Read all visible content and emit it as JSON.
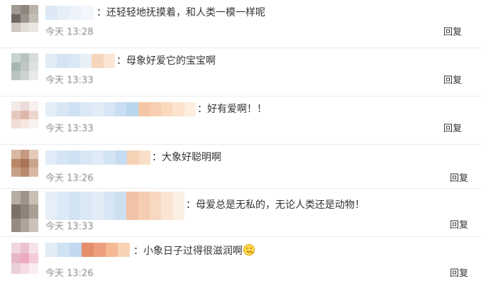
{
  "comments": [
    {
      "text": "：还轻轻地抚摸着，和人类一模一样呢",
      "time": "今天 13:28",
      "reply": "回复"
    },
    {
      "text": "：母象好爱它的宝宝啊",
      "time": "今天 13:33",
      "reply": "回复"
    },
    {
      "text": "：好有爱啊！！",
      "time": "今天 13:33",
      "reply": "回复"
    },
    {
      "text": "：大象好聪明啊",
      "time": "今天 13:26",
      "reply": "回复"
    },
    {
      "text": "：母爱总是无私的，无论人类还是动物！",
      "time": "今天 13:33",
      "reply": "回复"
    },
    {
      "text": "：小象日子过得很滋润啊",
      "time": "今天 13:26",
      "reply": "回复",
      "emoji": "smiling-face-emoji"
    }
  ],
  "colors": {
    "text": "#333333",
    "time": "#888888",
    "divider": "#ececec",
    "blur_blue": "#cfe3f4",
    "blur_peach": "#f4c7a6"
  }
}
